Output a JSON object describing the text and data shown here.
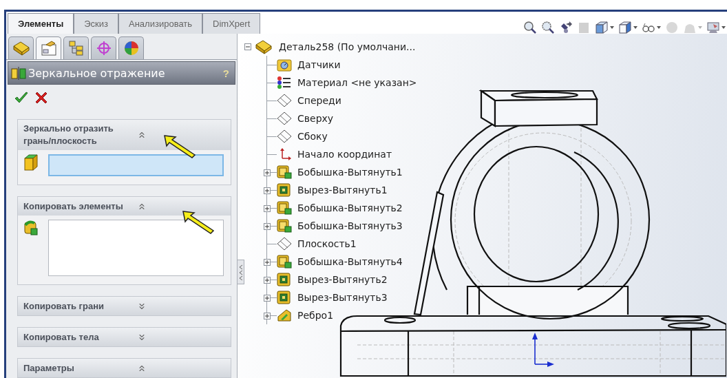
{
  "tabs": [
    {
      "label": "Элементы",
      "selected": true
    },
    {
      "label": "Эскиз",
      "selected": false
    },
    {
      "label": "Анализировать",
      "selected": false
    },
    {
      "label": "DimXpert",
      "selected": false
    }
  ],
  "panel_tabs": [
    {
      "kind": "feature-tree",
      "selected": false
    },
    {
      "kind": "property",
      "selected": true
    },
    {
      "kind": "configuration",
      "selected": false
    },
    {
      "kind": "dimxpert",
      "selected": false
    },
    {
      "kind": "display",
      "selected": false
    }
  ],
  "property_manager": {
    "title": "Зеркальное отражение",
    "help": "?",
    "sections": [
      {
        "title": "Зеркально отразить грань/плоскость",
        "expanded": true,
        "kind": "field",
        "focused": true
      },
      {
        "title": "Копировать элементы",
        "expanded": true,
        "kind": "list"
      },
      {
        "title": "Копировать грани",
        "expanded": false
      },
      {
        "title": "Копировать тела",
        "expanded": false
      },
      {
        "title": "Параметры",
        "expanded": true
      }
    ]
  },
  "tree": {
    "label": "Деталь258  (По умолчани...",
    "expanded": true,
    "children": [
      {
        "label": "Датчики",
        "kind": "sensors"
      },
      {
        "label": "Материал <не указан>",
        "kind": "material"
      },
      {
        "label": "Спереди",
        "kind": "plane"
      },
      {
        "label": "Сверху",
        "kind": "plane"
      },
      {
        "label": "Сбоку",
        "kind": "plane"
      },
      {
        "label": "Начало координат",
        "kind": "origin"
      },
      {
        "label": "Бобышка-Вытянуть1",
        "kind": "boss",
        "expanded": false
      },
      {
        "label": "Вырез-Вытянуть1",
        "kind": "cut",
        "expanded": false
      },
      {
        "label": "Бобышка-Вытянуть2",
        "kind": "boss",
        "expanded": false
      },
      {
        "label": "Бобышка-Вытянуть3",
        "kind": "boss",
        "expanded": false
      },
      {
        "label": "Плоскость1",
        "kind": "plane"
      },
      {
        "label": "Бобышка-Вытянуть4",
        "kind": "boss",
        "expanded": false
      },
      {
        "label": "Вырез-Вытянуть2",
        "kind": "cut",
        "expanded": false
      },
      {
        "label": "Вырез-Вытянуть3",
        "kind": "cut",
        "expanded": false
      },
      {
        "label": "Ребро1",
        "kind": "rib",
        "expanded": false
      }
    ]
  },
  "toolbar": [
    {
      "kind": "zoom-fit",
      "disabled": false,
      "dropdown": false
    },
    {
      "kind": "zoom-area",
      "disabled": false,
      "dropdown": false
    },
    {
      "kind": "previous-view",
      "disabled": false,
      "dropdown": false
    },
    {
      "kind": "section",
      "disabled": true,
      "dropdown": false
    },
    {
      "kind": "orientation",
      "disabled": false,
      "dropdown": true
    },
    {
      "kind": "display-style",
      "disabled": false,
      "dropdown": true
    },
    {
      "kind": "hide-show",
      "disabled": false,
      "dropdown": true
    },
    {
      "kind": "appearance",
      "disabled": true,
      "dropdown": false
    },
    {
      "kind": "scene",
      "disabled": true,
      "dropdown": true
    },
    {
      "kind": "view-settings",
      "disabled": false,
      "dropdown": true
    }
  ]
}
